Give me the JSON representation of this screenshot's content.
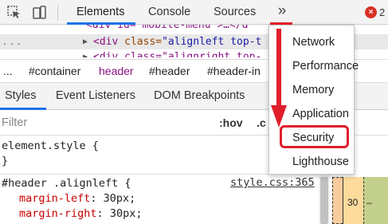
{
  "tabs": {
    "elements": "Elements",
    "console": "Console",
    "sources": "Sources",
    "more": "»"
  },
  "status": {
    "error_badge": "×",
    "error_count": "2"
  },
  "dom": {
    "line1_pre": "<div id=\"mobile-menu\">…</d",
    "line2_tag_open": "<div ",
    "line2_attr": "class=",
    "line2_val": "\"alignleft top-t",
    "line3": "<div class=\"alignright top-",
    "dots": "..."
  },
  "breadcrumb": [
    "...",
    "#container",
    "header",
    "#header",
    "#header-in"
  ],
  "subtabs": {
    "styles": "Styles",
    "event_listeners": "Event Listeners",
    "dom_breakpoints": "DOM Breakpoints"
  },
  "filter": {
    "placeholder": "Filter",
    "hov": ":hov",
    "cls": ".c"
  },
  "styles": {
    "element_style": "element.style {",
    "element_style_close": "}",
    "rule_selector": "#header .alignleft {",
    "rule_source": "style.css:365",
    "props": [
      {
        "name": "margin-left",
        "value": "30px;"
      },
      {
        "name": "margin-right",
        "value": "30px;"
      }
    ]
  },
  "box_model": {
    "margin_value": "30",
    "padding_value": "–"
  },
  "menu": {
    "items": [
      "Network",
      "Performance",
      "Memory",
      "Application",
      "Security",
      "Lighthouse"
    ],
    "highlighted": "Security"
  },
  "colors": {
    "accent_blue": "#1a73e8",
    "annotation_red": "#e01e2b"
  }
}
